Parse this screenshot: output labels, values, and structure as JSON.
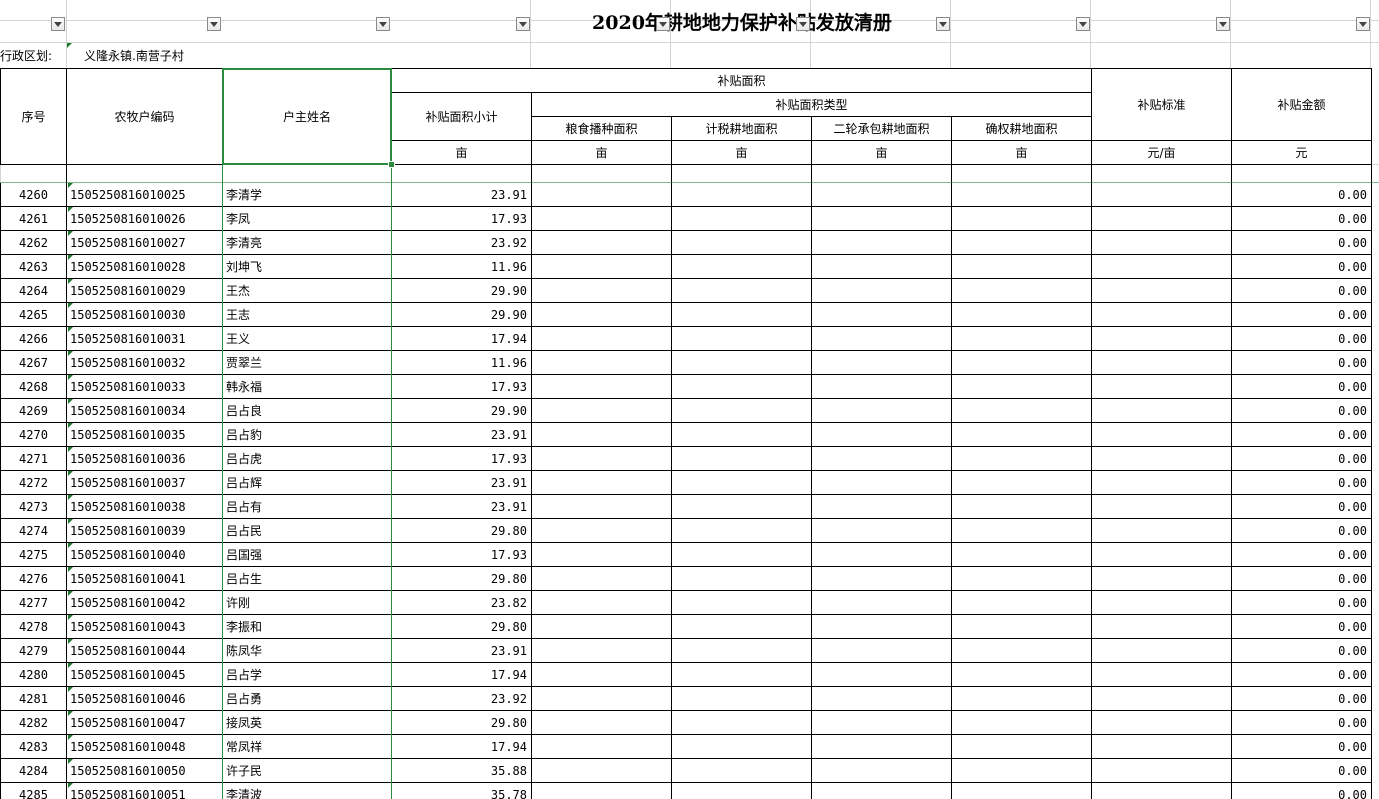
{
  "sheet": {
    "title": "2020年耕地地力保护补贴发放清册",
    "region_label": "行政区划:",
    "region_value": "义隆永镇.南营子村"
  },
  "header": {
    "seq": "序号",
    "household_code": "农牧户编码",
    "owner_name": "户主姓名",
    "subsidy_area": "补贴面积",
    "area_subtotal": "补贴面积小计",
    "area_types": "补贴面积类型",
    "grain_area": "粮食播种面积",
    "tax_area": "计税耕地面积",
    "contract_area": "二轮承包耕地面积",
    "confirmed_area": "确权耕地面积",
    "standard": "补贴标准",
    "amount": "补贴金额",
    "unit_mu": "亩",
    "unit_std": "元/亩",
    "unit_yuan": "元"
  },
  "rows": [
    {
      "seq": "4260",
      "code": "1505250816010025",
      "name": "李清学",
      "area": "23.91",
      "amount": "0.00"
    },
    {
      "seq": "4261",
      "code": "1505250816010026",
      "name": "李凤",
      "area": "17.93",
      "amount": "0.00"
    },
    {
      "seq": "4262",
      "code": "1505250816010027",
      "name": "李清亮",
      "area": "23.92",
      "amount": "0.00"
    },
    {
      "seq": "4263",
      "code": "1505250816010028",
      "name": "刘坤飞",
      "area": "11.96",
      "amount": "0.00"
    },
    {
      "seq": "4264",
      "code": "1505250816010029",
      "name": "王杰",
      "area": "29.90",
      "amount": "0.00"
    },
    {
      "seq": "4265",
      "code": "1505250816010030",
      "name": "王志",
      "area": "29.90",
      "amount": "0.00"
    },
    {
      "seq": "4266",
      "code": "1505250816010031",
      "name": "王义",
      "area": "17.94",
      "amount": "0.00"
    },
    {
      "seq": "4267",
      "code": "1505250816010032",
      "name": "贾翠兰",
      "area": "11.96",
      "amount": "0.00"
    },
    {
      "seq": "4268",
      "code": "1505250816010033",
      "name": "韩永福",
      "area": "17.93",
      "amount": "0.00"
    },
    {
      "seq": "4269",
      "code": "1505250816010034",
      "name": "吕占良",
      "area": "29.90",
      "amount": "0.00"
    },
    {
      "seq": "4270",
      "code": "1505250816010035",
      "name": "吕占豹",
      "area": "23.91",
      "amount": "0.00"
    },
    {
      "seq": "4271",
      "code": "1505250816010036",
      "name": "吕占虎",
      "area": "17.93",
      "amount": "0.00"
    },
    {
      "seq": "4272",
      "code": "1505250816010037",
      "name": "吕占辉",
      "area": "23.91",
      "amount": "0.00"
    },
    {
      "seq": "4273",
      "code": "1505250816010038",
      "name": "吕占有",
      "area": "23.91",
      "amount": "0.00"
    },
    {
      "seq": "4274",
      "code": "1505250816010039",
      "name": "吕占民",
      "area": "29.80",
      "amount": "0.00"
    },
    {
      "seq": "4275",
      "code": "1505250816010040",
      "name": "吕国强",
      "area": "17.93",
      "amount": "0.00"
    },
    {
      "seq": "4276",
      "code": "1505250816010041",
      "name": "吕占生",
      "area": "29.80",
      "amount": "0.00"
    },
    {
      "seq": "4277",
      "code": "1505250816010042",
      "name": "许刚",
      "area": "23.82",
      "amount": "0.00"
    },
    {
      "seq": "4278",
      "code": "1505250816010043",
      "name": "李振和",
      "area": "29.80",
      "amount": "0.00"
    },
    {
      "seq": "4279",
      "code": "1505250816010044",
      "name": "陈凤华",
      "area": "23.91",
      "amount": "0.00"
    },
    {
      "seq": "4280",
      "code": "1505250816010045",
      "name": "吕占学",
      "area": "17.94",
      "amount": "0.00"
    },
    {
      "seq": "4281",
      "code": "1505250816010046",
      "name": "吕占勇",
      "area": "23.92",
      "amount": "0.00"
    },
    {
      "seq": "4282",
      "code": "1505250816010047",
      "name": "接凤英",
      "area": "29.80",
      "amount": "0.00"
    },
    {
      "seq": "4283",
      "code": "1505250816010048",
      "name": "常凤祥",
      "area": "17.94",
      "amount": "0.00"
    },
    {
      "seq": "4284",
      "code": "1505250816010050",
      "name": "许子民",
      "area": "35.88",
      "amount": "0.00"
    },
    {
      "seq": "4285",
      "code": "1505250816010051",
      "name": "李清波",
      "area": "35.78",
      "amount": "0.00"
    }
  ],
  "colors": {
    "selection": "#2a8a3e",
    "gridline": "#d4d4d4",
    "border": "#000000"
  }
}
